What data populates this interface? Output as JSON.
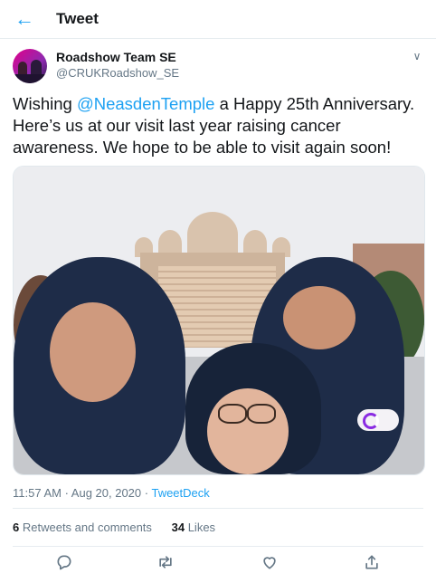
{
  "header": {
    "title": "Tweet",
    "back_icon": "arrow-left-icon"
  },
  "tweet": {
    "author_name": "Roadshow Team SE",
    "author_handle": "@CRUKRoadshow_SE",
    "text_before": "Wishing ",
    "mention": "@NeasdenTemple",
    "text_after": " a Happy 25th Anniversary. Here’s us at our visit last year raising cancer awareness. We hope to be able to visit again soon!",
    "time_date": "11:57 AM · Aug 20, 2020 · ",
    "source": "TweetDeck",
    "retweets_count": "6",
    "retweets_label": "Retweets and comments",
    "likes_count": "34",
    "likes_label": "Likes"
  },
  "actions": [
    "reply-icon",
    "retweet-icon",
    "like-icon",
    "share-icon"
  ],
  "colors": {
    "accent": "#1da1f2",
    "text": "#14171a",
    "muted": "#657786",
    "border": "#e6ecf0"
  }
}
